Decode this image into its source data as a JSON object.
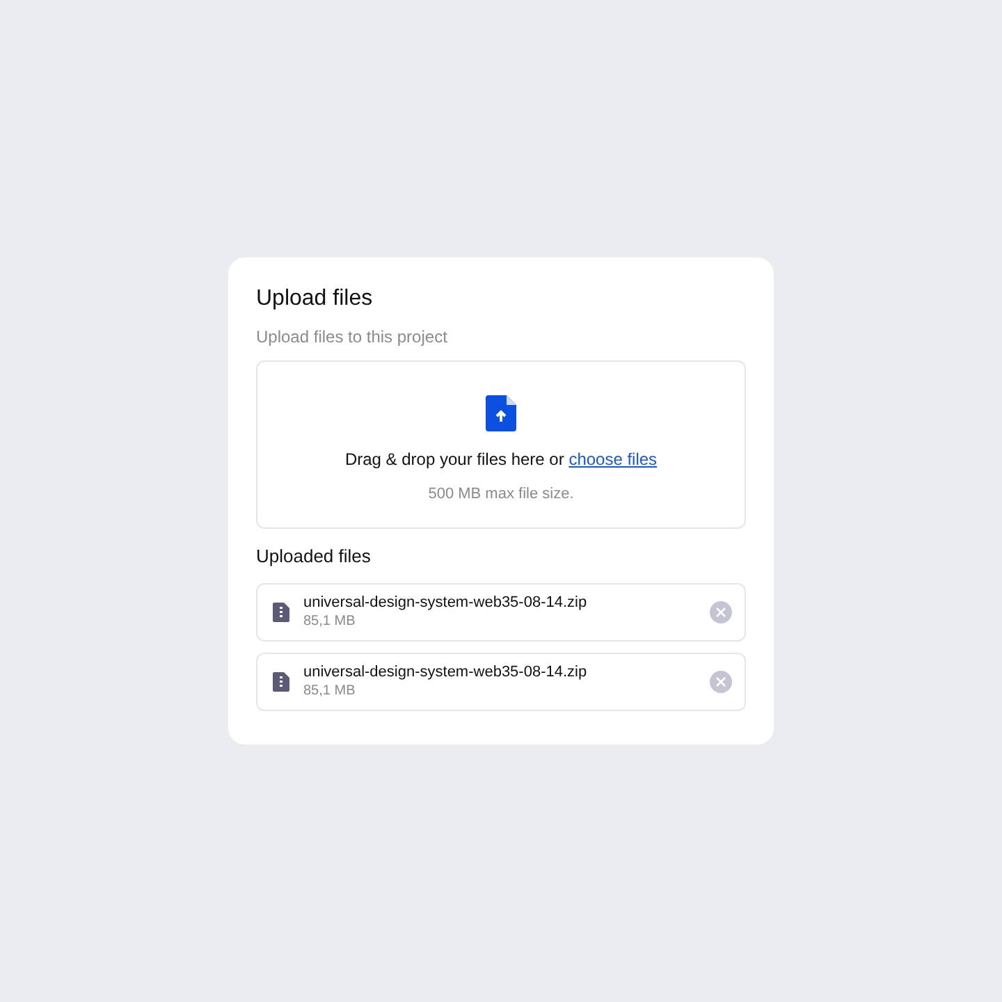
{
  "card": {
    "title": "Upload files",
    "subtitle": "Upload files to this project"
  },
  "dropzone": {
    "prompt": "Drag & drop your files here or",
    "link": "choose files",
    "note": "500 MB max file size."
  },
  "uploaded": {
    "heading": "Uploaded files",
    "files": [
      {
        "name": "universal-design-system-web35-08-14.zip",
        "size": "85,1 MB"
      },
      {
        "name": "universal-design-system-web35-08-14.zip",
        "size": "85,1 MB"
      }
    ]
  }
}
